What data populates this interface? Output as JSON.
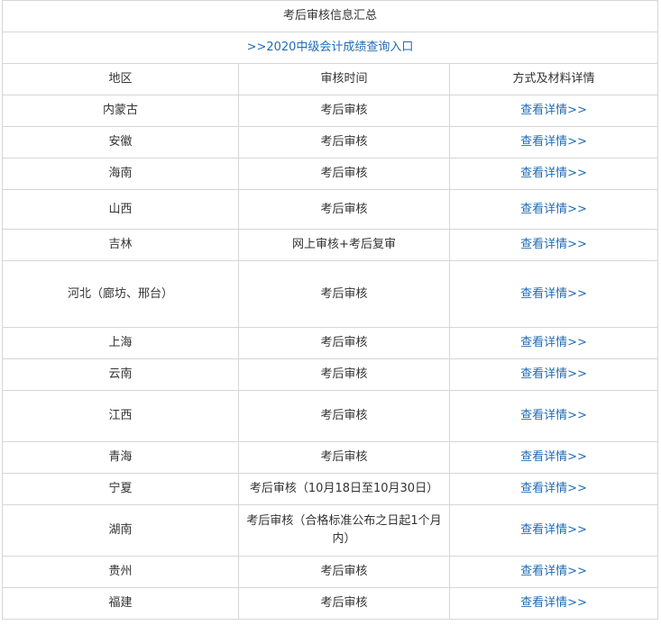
{
  "table": {
    "title": "考后审核信息汇总",
    "banner_link": ">>2020中级会计成绩查询入口",
    "headers": [
      "地区",
      "审核时间",
      "方式及材料详情"
    ],
    "rows": [
      {
        "region": "内蒙古",
        "time": "考后审核",
        "detail": "查看详情>>"
      },
      {
        "region": "安徽",
        "time": "考后审核",
        "detail": "查看详情>>"
      },
      {
        "region": "海南",
        "time": "考后审核",
        "detail": "查看详情>>"
      },
      {
        "region": "山西",
        "time": "考后审核",
        "detail": "查看详情>>"
      },
      {
        "region": "吉林",
        "time": "网上审核+考后复审",
        "detail": "查看详情>>"
      },
      {
        "region": "河北（廊坊、邢台）",
        "time": "考后审核",
        "detail": "查看详情>>"
      },
      {
        "region": "上海",
        "time": "考后审核",
        "detail": "查看详情>>"
      },
      {
        "region": "云南",
        "time": "考后审核",
        "detail": "查看详情>>"
      },
      {
        "region": "江西",
        "time": "考后审核",
        "detail": "查看详情>>"
      },
      {
        "region": "青海",
        "time": "考后审核",
        "detail": "查看详情>>"
      },
      {
        "region": "宁夏",
        "time": "考后审核（10月18日至10月30日）",
        "detail": "查看详情>>"
      },
      {
        "region": "湖南",
        "time": "考后审核（合格标准公布之日起1个月内）",
        "detail": "查看详情>>"
      },
      {
        "region": "贵州",
        "time": "考后审核",
        "detail": "查看详情>>"
      },
      {
        "region": "福建",
        "time": "考后审核",
        "detail": "查看详情>>"
      }
    ]
  },
  "colors": {
    "link": "#1f6bb5",
    "border": "#d6d6d6",
    "text": "#333333"
  }
}
